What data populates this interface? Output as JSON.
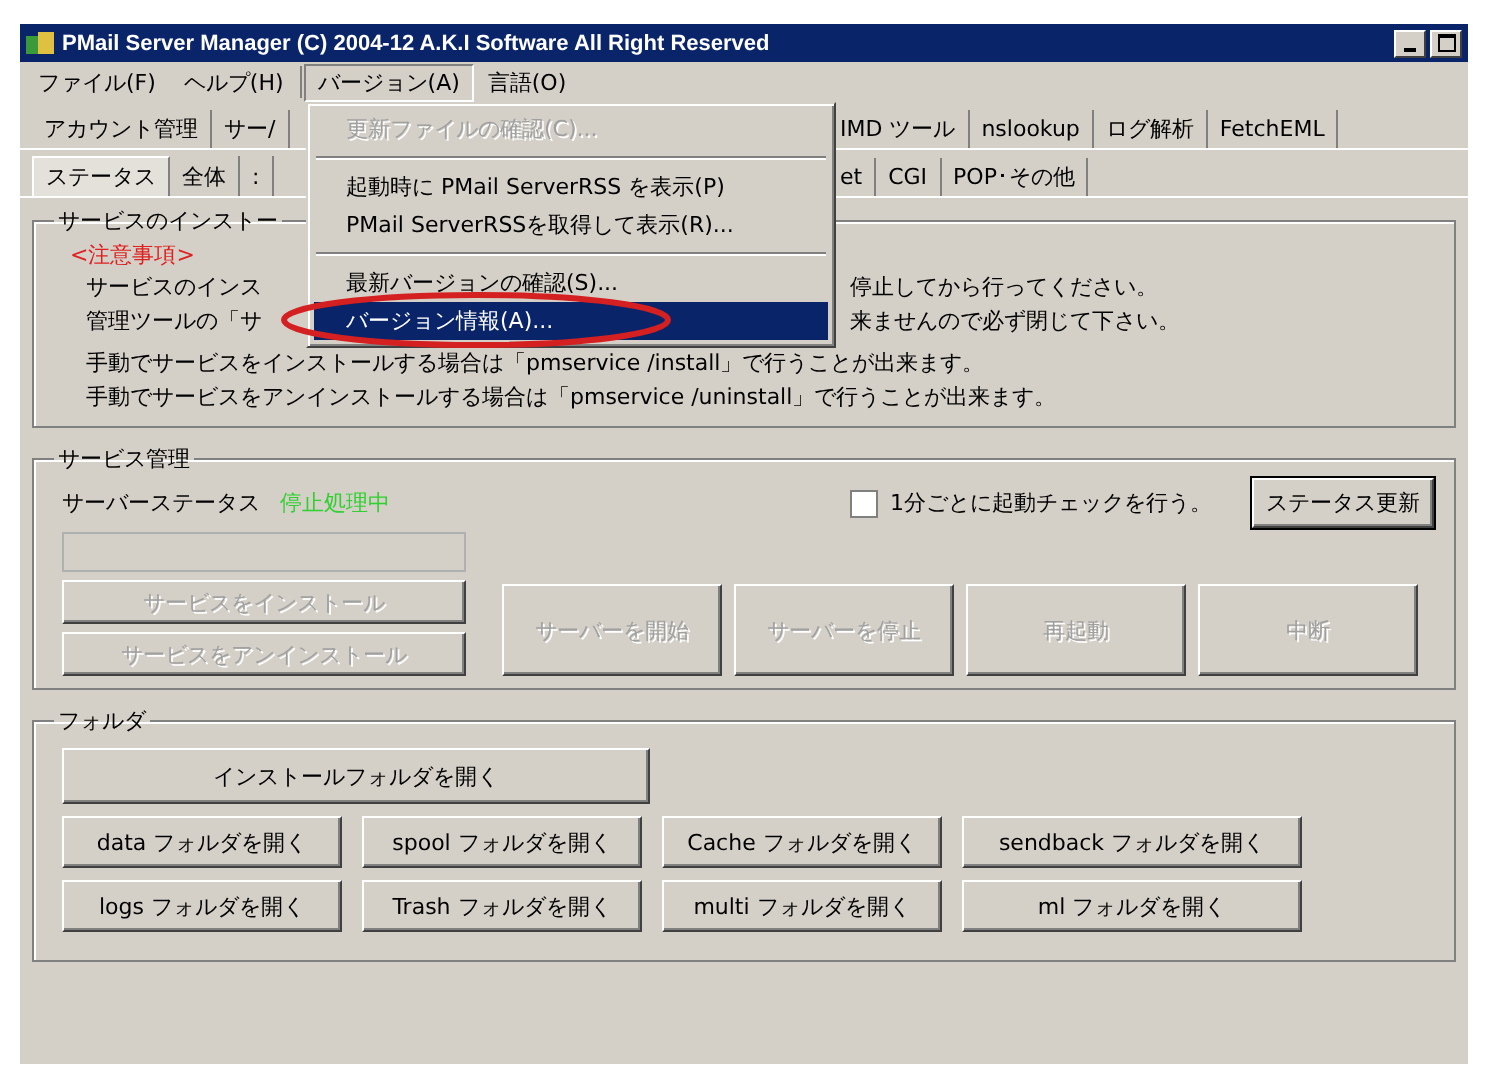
{
  "window": {
    "title": "PMail Server Manager (C) 2004-12 A.K.I Software All Right Reserved"
  },
  "menu_bar": [
    {
      "label": "ファイル(F)",
      "selected": false
    },
    {
      "label": "ヘルプ(H)",
      "selected": false
    },
    {
      "label": "バージョン(A)",
      "selected": true
    },
    {
      "label": "言語(O)",
      "selected": false
    }
  ],
  "tab_rows": [
    {
      "left": [
        {
          "label": "アカウント管理",
          "selected": false
        },
        {
          "label": "サー/",
          "selected": false
        }
      ],
      "right": [
        {
          "label": "IMD ツール",
          "selected": false
        },
        {
          "label": "nslookup",
          "selected": false
        },
        {
          "label": "ログ解析",
          "selected": false
        },
        {
          "label": "FetchEML",
          "selected": false
        }
      ]
    },
    {
      "left": [
        {
          "label": "ステータス",
          "selected": true
        },
        {
          "label": "全体",
          "selected": false
        },
        {
          "label": ":",
          "selected": false
        }
      ],
      "right": [
        {
          "label": "et",
          "selected": false
        },
        {
          "label": "CGI",
          "selected": false
        },
        {
          "label": "POP･その他",
          "selected": false
        }
      ]
    }
  ],
  "dropdown_menu": [
    {
      "kind": "item",
      "label": "更新ファイルの確認(C)...",
      "disabled": true,
      "selected": false
    },
    {
      "kind": "separator"
    },
    {
      "kind": "item",
      "label": "起動時に PMail ServerRSS を表示(P)",
      "disabled": false,
      "selected": false
    },
    {
      "kind": "item",
      "label": "PMail ServerRSSを取得して表示(R)...",
      "disabled": false,
      "selected": false
    },
    {
      "kind": "separator"
    },
    {
      "kind": "item",
      "label": "最新バージョンの確認(S)...",
      "disabled": false,
      "selected": false
    },
    {
      "kind": "item",
      "label": "バージョン情報(A)...",
      "disabled": false,
      "selected": true
    }
  ],
  "install_group": {
    "title": "サービスのインストー",
    "notice": "<注意事項>",
    "lines": [
      {
        "left": "サービスのインス",
        "right": "停止してから行ってください。"
      },
      {
        "left": "管理ツールの「サ",
        "right": "来ませんので必ず閉じて下さい。"
      },
      {
        "left": "手動でサービスをインストールする場合は「pmservice /install」で行うことが出来ます。"
      },
      {
        "left": "手動でサービスをアンインストールする場合は「pmservice /uninstall」で行うことが出来ます。"
      }
    ]
  },
  "service_group": {
    "title": "サービス管理",
    "status_label": "サーバーステータス",
    "status_value": "停止処理中",
    "auto_check": {
      "label": "1分ごとに起動チェックを行う。",
      "checked": false
    },
    "refresh_button": {
      "label": "ステータス更新",
      "disabled": false
    },
    "install_buttons": [
      {
        "label": "サービスをインストール",
        "disabled": true
      },
      {
        "label": "サービスをアンインストール",
        "disabled": true
      }
    ],
    "control_buttons": [
      {
        "label": "サーバーを開始",
        "disabled": true
      },
      {
        "label": "サーバーを停止",
        "disabled": true
      },
      {
        "label": "再起動",
        "disabled": true
      },
      {
        "label": "中断",
        "disabled": true
      }
    ]
  },
  "folder_group": {
    "title": "フォルダ",
    "main_button": "インストールフォルダを開く",
    "buttons": [
      "data フォルダを開く",
      "spool フォルダを開く",
      "Cache フォルダを開く",
      "sendback フォルダを開く",
      "logs フォルダを開く",
      "Trash フォルダを開く",
      "multi フォルダを開く",
      "ml フォルダを開く"
    ]
  }
}
